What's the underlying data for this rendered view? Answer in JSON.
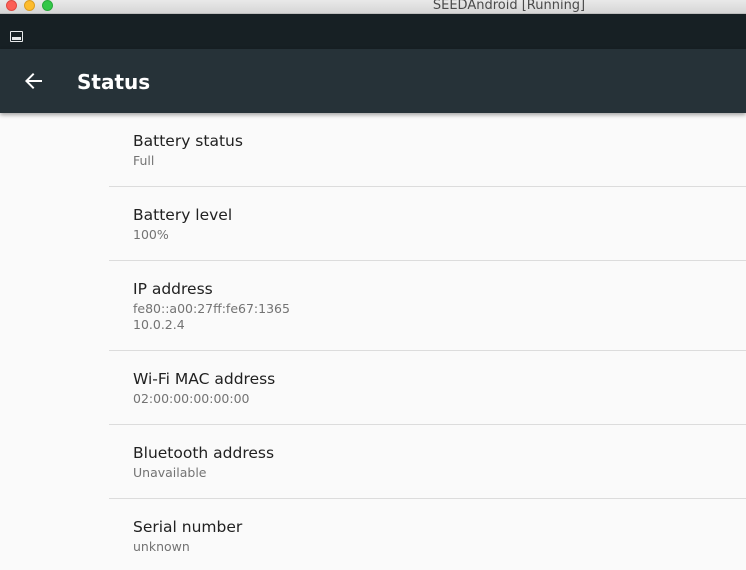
{
  "window": {
    "title": "SEEDAndroid [Running]"
  },
  "toolbar": {
    "title": "Status",
    "back_icon": "arrow-back-icon",
    "background": "#263238"
  },
  "status_items": [
    {
      "title": "Battery status",
      "summary": [
        "Full"
      ]
    },
    {
      "title": "Battery level",
      "summary": [
        "100%"
      ]
    },
    {
      "title": "IP address",
      "summary": [
        "fe80::a00:27ff:fe67:1365",
        "10.0.2.4"
      ]
    },
    {
      "title": "Wi-Fi MAC address",
      "summary": [
        "02:00:00:00:00:00"
      ]
    },
    {
      "title": "Bluetooth address",
      "summary": [
        "Unavailable"
      ]
    },
    {
      "title": "Serial number",
      "summary": [
        "unknown"
      ]
    }
  ]
}
